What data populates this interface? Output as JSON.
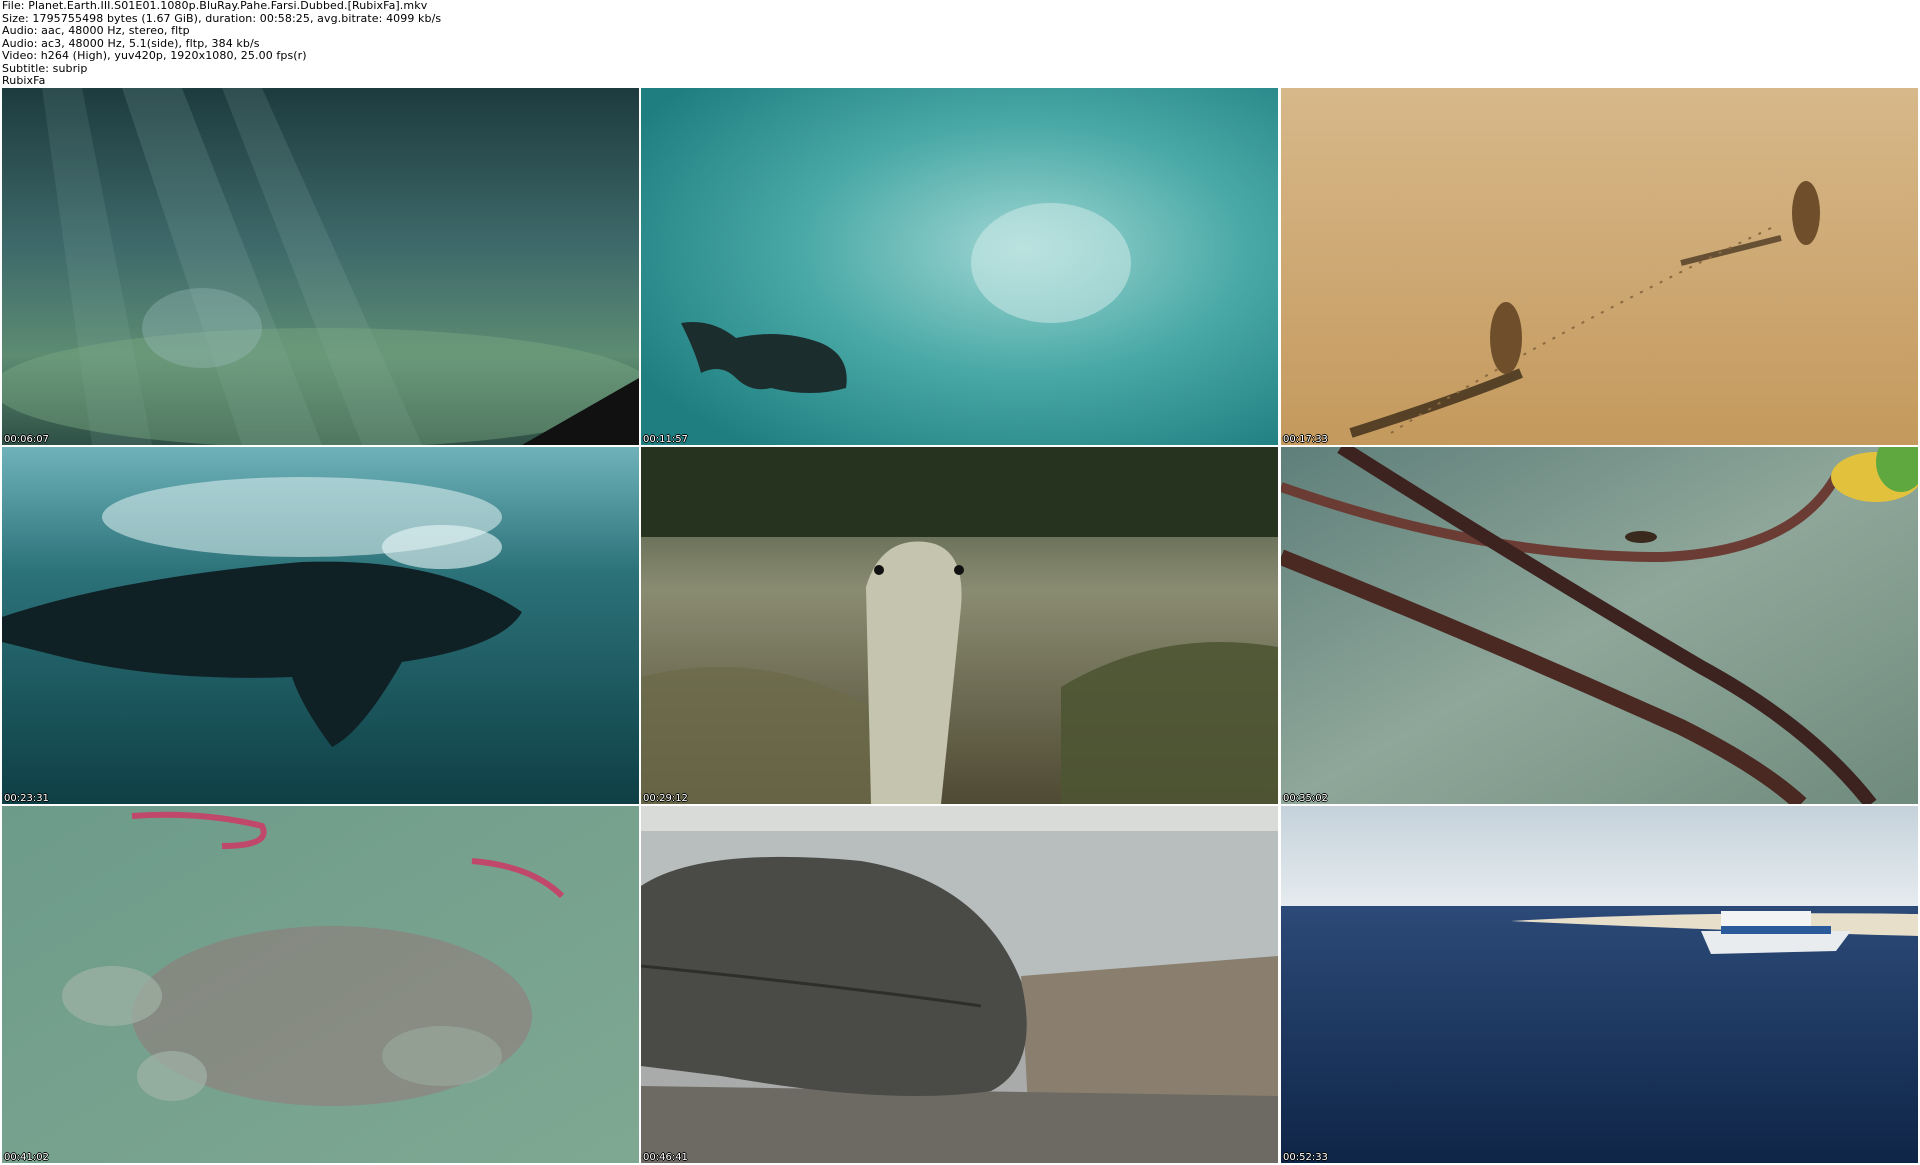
{
  "header": {
    "file": "File: Planet.Earth.III.S01E01.1080p.BluRay.Pahe.Farsi.Dubbed.[RubixFa].mkv",
    "size": "Size: 1795755498 bytes (1.67 GiB), duration: 00:58:25, avg.bitrate: 4099 kb/s",
    "audio1": "Audio: aac, 48000 Hz, stereo, fltp",
    "audio2": "Audio: ac3, 48000 Hz, 5.1(side), fltp, 384 kb/s",
    "video": "Video: h264 (High), yuv420p, 1920x1080, 25.00 fps(r)",
    "subtitle": "Subtitle: subrip",
    "tag": "RubixFa"
  },
  "thumbnails": [
    {
      "timestamp": "00:06:07",
      "scene": "underwater-light-rays"
    },
    {
      "timestamp": "00:11:57",
      "scene": "sea-lion-underwater"
    },
    {
      "timestamp": "00:17:33",
      "scene": "lions-on-desert-sand"
    },
    {
      "timestamp": "00:23:31",
      "scene": "whale-underwater"
    },
    {
      "timestamp": "00:29:12",
      "scene": "snake-on-seaweed"
    },
    {
      "timestamp": "00:35:02",
      "scene": "insect-on-mangrove-branch"
    },
    {
      "timestamp": "00:41:02",
      "scene": "flamingos-aerial"
    },
    {
      "timestamp": "00:46:41",
      "scene": "sea-turtle-on-rocks"
    },
    {
      "timestamp": "00:52:33",
      "scene": "boat-near-island"
    }
  ],
  "colors": {
    "background": "#ffffff",
    "text": "#000000",
    "timestamp": "#ffffff"
  }
}
